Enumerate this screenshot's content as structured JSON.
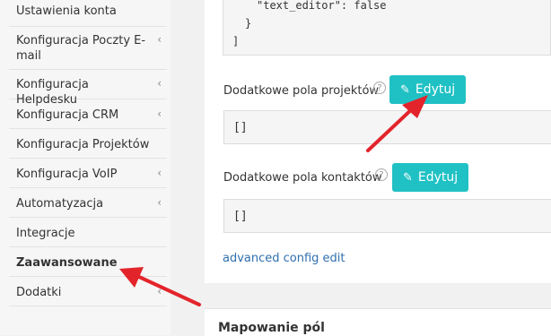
{
  "sidebar": {
    "items": [
      {
        "label": "Ustawienia konta",
        "chevron": false,
        "bold": false
      },
      {
        "label": "Konfiguracja Poczty E-mail",
        "chevron": true,
        "bold": false
      },
      {
        "label": "Konfiguracja Helpdesku",
        "chevron": true,
        "bold": false
      },
      {
        "label": "Konfiguracja CRM",
        "chevron": true,
        "bold": false
      },
      {
        "label": "Konfiguracja Projektów",
        "chevron": false,
        "bold": false
      },
      {
        "label": "Konfiguracja VoIP",
        "chevron": true,
        "bold": false
      },
      {
        "label": "Automatyzacja",
        "chevron": true,
        "bold": false
      },
      {
        "label": "Integracje",
        "chevron": false,
        "bold": false
      },
      {
        "label": "Zaawansowane",
        "chevron": false,
        "bold": true
      },
      {
        "label": "Dodatki",
        "chevron": true,
        "bold": false
      }
    ]
  },
  "code": {
    "line1": "\"text_editor\": false",
    "line2": "}",
    "line3": "]"
  },
  "project_fields": {
    "label": "Dodatkowe pola projektów",
    "help": "?",
    "button": "Edytuj",
    "value": "[]"
  },
  "contact_fields": {
    "label": "Dodatkowe pola kontaktów",
    "help": "?",
    "button": "Edytuj",
    "value": "[]"
  },
  "advanced_link": "advanced config edit",
  "section_title": "Mapowanie pól",
  "colors": {
    "button": "#20c1c4",
    "arrow": "#e3242b",
    "link": "#2f6fae"
  },
  "icons": {
    "edit": "edit-icon",
    "chevron": "chevron-left-icon",
    "help": "help-icon"
  }
}
